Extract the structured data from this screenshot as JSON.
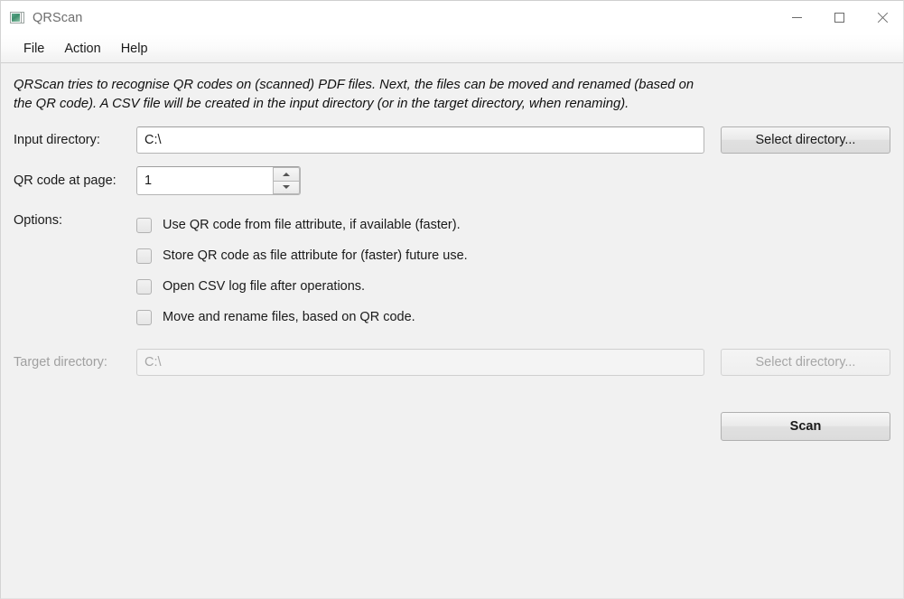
{
  "window": {
    "title": "QRScan",
    "icon": "picture-app-icon",
    "controls": {
      "minimize": "minimize-icon",
      "maximize": "maximize-icon",
      "close": "close-icon"
    }
  },
  "menu": {
    "items": [
      {
        "label": "File"
      },
      {
        "label": "Action"
      },
      {
        "label": "Help"
      }
    ]
  },
  "description": "QRScan tries to recognise QR codes on (scanned) PDF files. Next, the files can be moved and renamed (based on the QR code). A CSV file will be created in the input directory (or in the target directory, when renaming).",
  "form": {
    "input_directory": {
      "label": "Input directory:",
      "value": "C:\\",
      "placeholder": "",
      "button_label": "Select directory...",
      "enabled": true
    },
    "qr_code_page": {
      "label": "QR code at page:",
      "value": "1",
      "spinner_up_icon": "arrow-up-icon",
      "spinner_down_icon": "arrow-down-icon"
    },
    "options": {
      "label": "Options:",
      "items": [
        {
          "label": "Use QR code from file attribute, if available (faster).",
          "checked": false
        },
        {
          "label": "Store QR code as file attribute for (faster) future use.",
          "checked": false
        },
        {
          "label": "Open CSV log file after operations.",
          "checked": false
        },
        {
          "label": "Move and rename files, based on QR code.",
          "checked": false
        }
      ]
    },
    "target_directory": {
      "label": "Target directory:",
      "value": "C:\\",
      "placeholder": "",
      "button_label": "Select directory...",
      "enabled": false
    },
    "scan_button": {
      "label": "Scan"
    }
  },
  "colors": {
    "window_background": "#f1f1f1",
    "titlebar_background": "#ffffff",
    "text": "#1a1a1a",
    "disabled_text": "#a0a0a0",
    "field_background": "#ffffff",
    "border": "#b4b4b4",
    "icon_accent": "#3f8f6e"
  }
}
